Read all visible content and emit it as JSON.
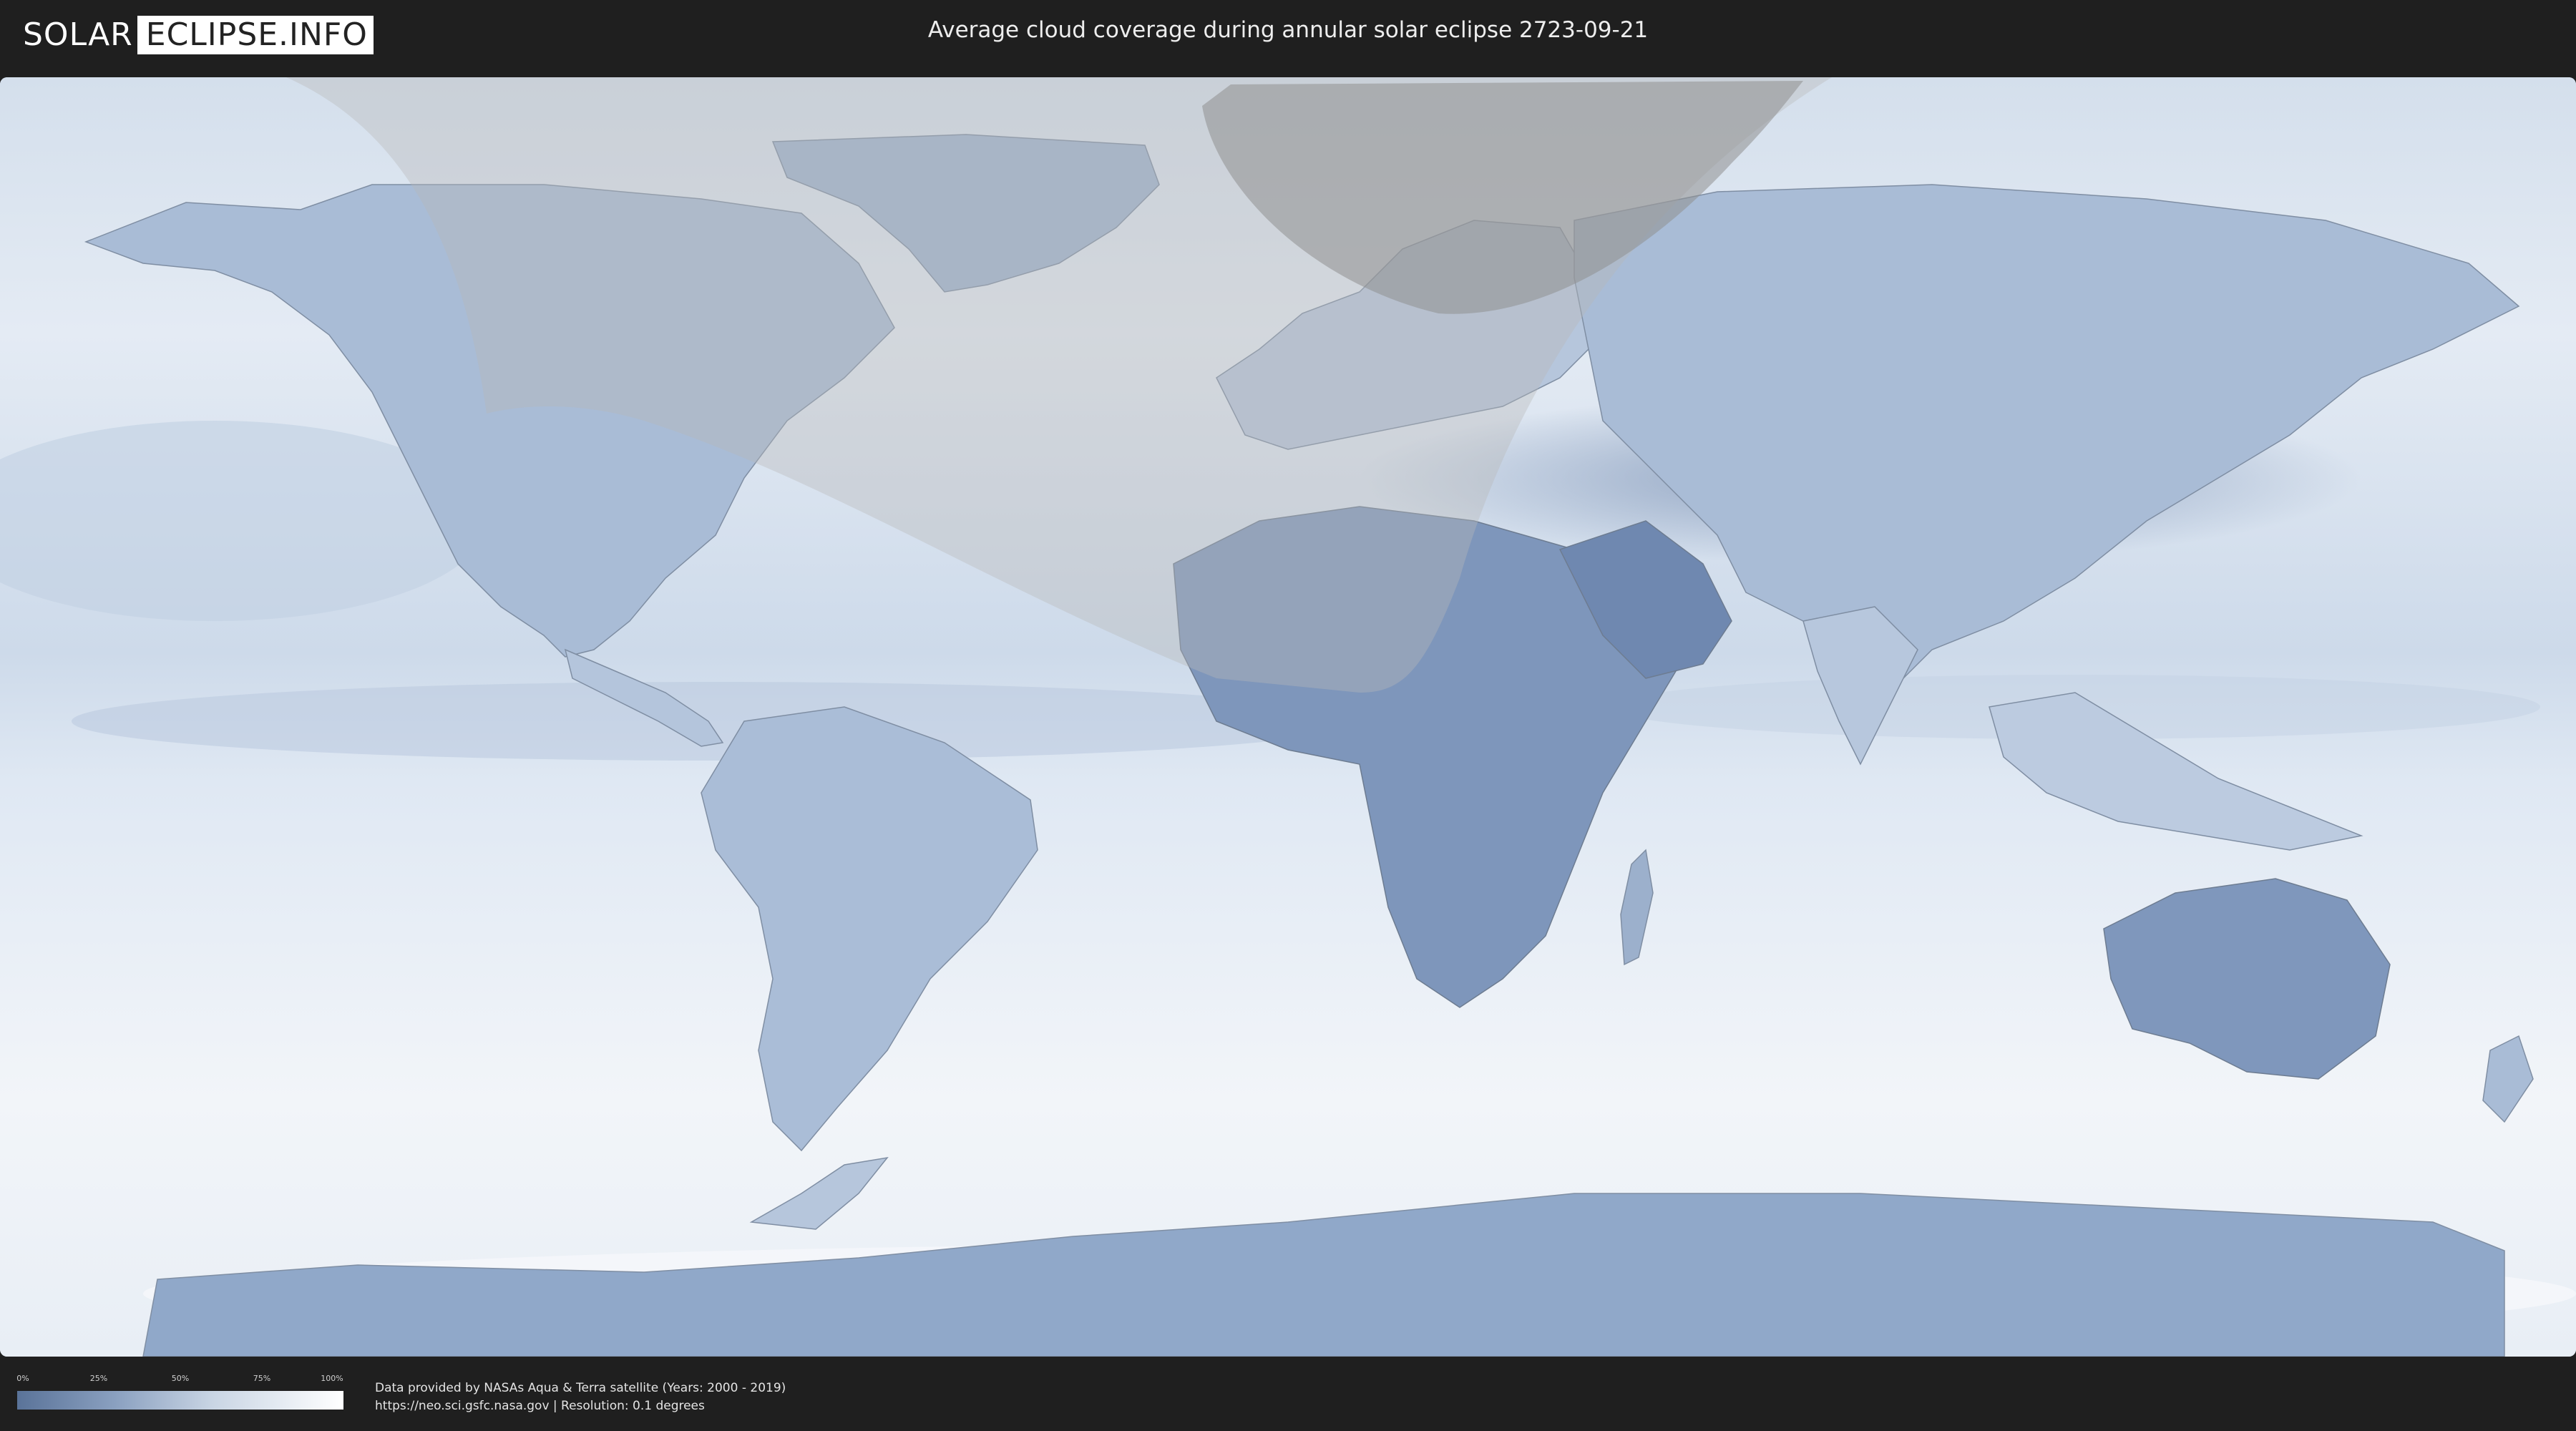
{
  "header": {
    "logo": {
      "part1": "SOLAR",
      "part2": "ECLIPSE.INFO"
    },
    "title": "Average cloud coverage during annular solar eclipse 2723-09-21"
  },
  "map": {
    "projection": "equirectangular",
    "layer": "average cloud coverage",
    "colors": {
      "clear": "#5a7399",
      "cloudy": "#ffffff",
      "eclipse_shadow": "#8a8a8a"
    },
    "continent_labels": []
  },
  "legend": {
    "ticks": [
      "0%",
      "25%",
      "50%",
      "75%",
      "100%"
    ]
  },
  "footer": {
    "credit_line1": "Data provided by NASAs Aqua & Terra satellite (Years: 2000 - 2019)",
    "credit_line2": "https://neo.sci.gsfc.nasa.gov | Resolution: 0.1 degrees"
  }
}
